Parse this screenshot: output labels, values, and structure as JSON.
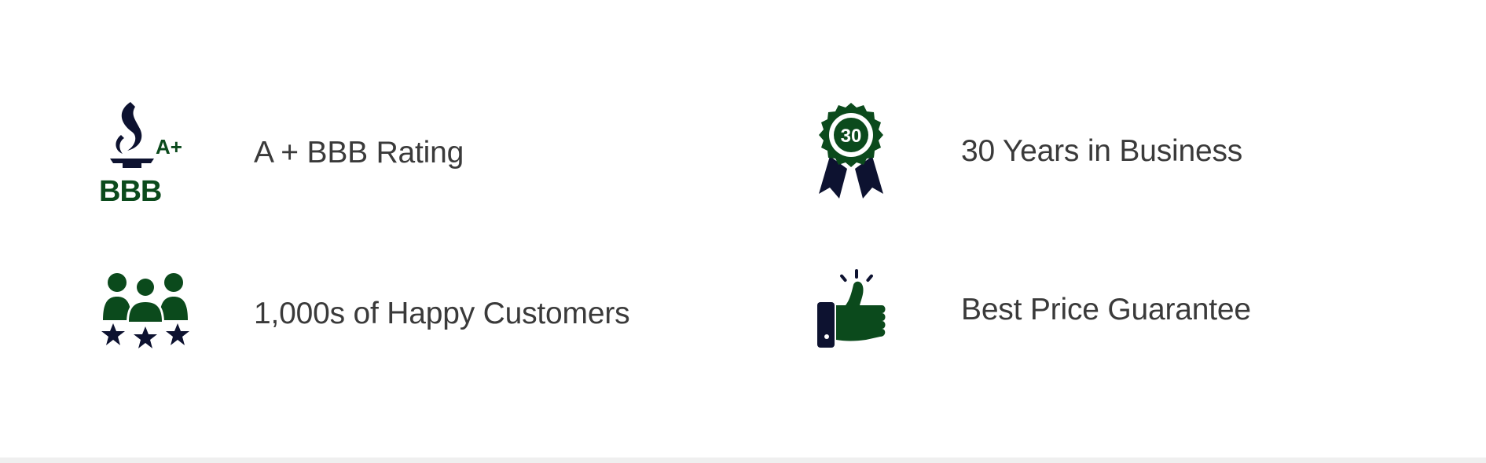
{
  "features": {
    "bbb": {
      "label": "A + BBB Rating",
      "icon": "bbb-accredited-logo",
      "badge_text": "A+",
      "logo_text": "BBB"
    },
    "years": {
      "label": "30 Years in Business",
      "icon": "award-ribbon-icon",
      "badge_number": "30"
    },
    "customers": {
      "label": "1,000s of Happy Customers",
      "icon": "happy-customers-stars-icon"
    },
    "price": {
      "label": "Best Price Guarantee",
      "icon": "thumbs-up-icon"
    }
  },
  "colors": {
    "brand_green": "#0b4a1c",
    "navy": "#0d1230",
    "text": "#3a3a3a",
    "background": "#ffffff",
    "footer_strip": "#efefef"
  }
}
